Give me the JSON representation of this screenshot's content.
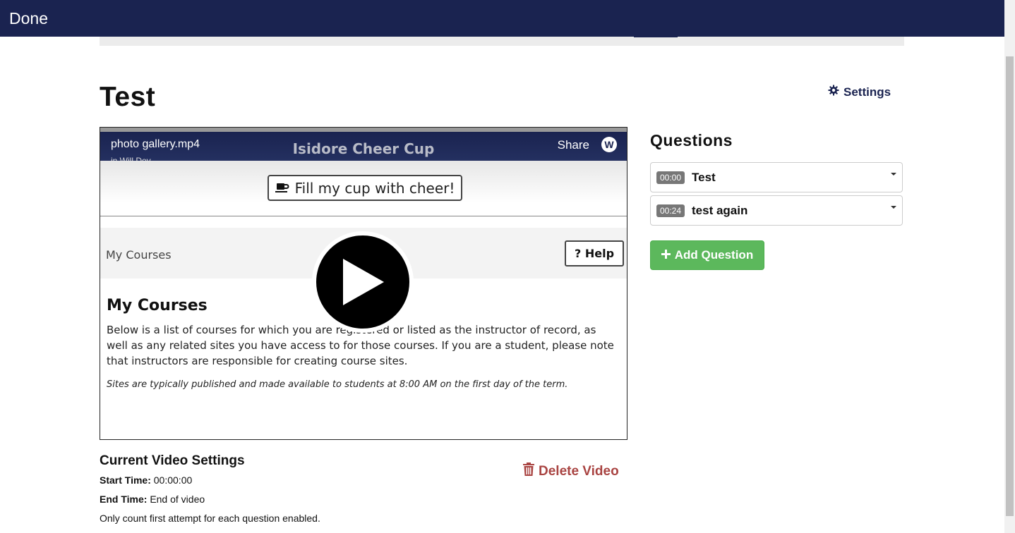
{
  "topbar": {
    "done_label": "Done",
    "color": "#1a2350"
  },
  "page": {
    "title": "Test",
    "settings_label": "Settings"
  },
  "video": {
    "filename": "photo gallery.mp4",
    "channel": "in Will Dev",
    "frame_title": "Isidore Cheer Cup",
    "share_label": "Share",
    "logo_letter": "W",
    "cheer_button": "Fill my cup with cheer!",
    "breadcrumb": "My Courses",
    "help_button": "? Help",
    "heading": "My Courses",
    "paragraph": "Below is a list of courses for which you are registered or listed as the instructor of record, as well as any related sites you have access to for those courses. If you are a student, please note that instructors are responsible for creating course sites.",
    "note": "Sites are typically published and made available to students at 8:00 AM on the first day of the term."
  },
  "questions": {
    "title": "Questions",
    "items": [
      {
        "time": "00:00",
        "label": "Test"
      },
      {
        "time": "00:24",
        "label": "test again"
      }
    ],
    "add_label": "Add Question",
    "add_color": "#5cb85c"
  },
  "current_settings": {
    "title": "Current Video Settings",
    "delete_label": "Delete Video",
    "delete_color": "#a94442",
    "start_label": "Start Time:",
    "start_value": "00:00:00",
    "end_label": "End Time:",
    "end_value": "End of video",
    "note": "Only count first attempt for each question enabled."
  }
}
